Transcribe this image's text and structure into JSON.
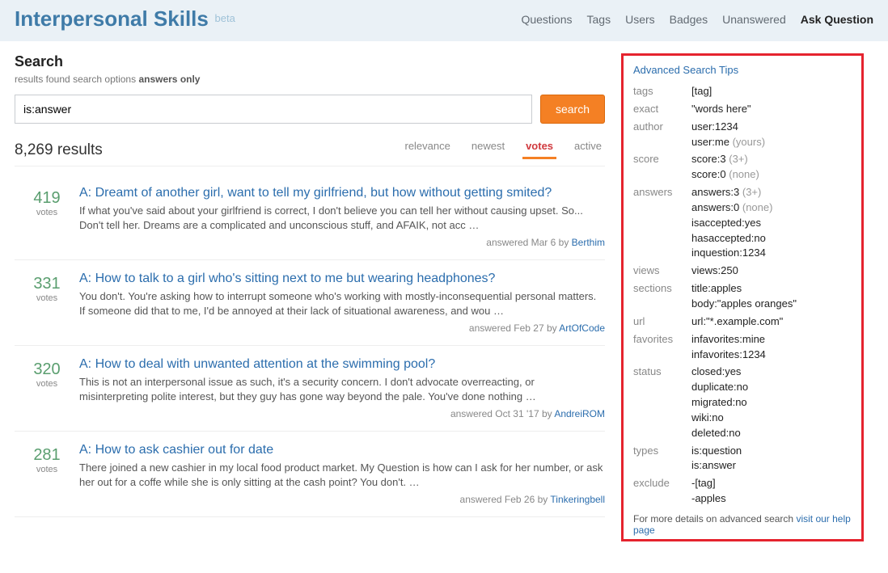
{
  "header": {
    "site_title": "Interpersonal Skills",
    "beta": "beta",
    "nav": {
      "questions": "Questions",
      "tags": "Tags",
      "users": "Users",
      "badges": "Badges",
      "unanswered": "Unanswered",
      "ask": "Ask Question"
    }
  },
  "search": {
    "heading": "Search",
    "sub_found": "results found",
    "sub_options": "search options",
    "sub_filter": "answers only",
    "query": "is:answer",
    "button": "search",
    "result_count": "8,269 results"
  },
  "tabs": {
    "relevance": "relevance",
    "newest": "newest",
    "votes": "votes",
    "active": "active"
  },
  "results": [
    {
      "votes": "419",
      "votes_lbl": "votes",
      "title": "A: Dreamt of another girl, want to tell my girlfriend, but how without getting smited?",
      "excerpt": "If what you've said about your girlfriend is correct, I don't believe you can tell her without causing upset. So... Don't tell her. Dreams are a complicated and unconscious stuff, and AFAIK, not acc …",
      "meta_prefix": "answered Mar 6 by ",
      "author": "Berthim"
    },
    {
      "votes": "331",
      "votes_lbl": "votes",
      "title": "A: How to talk to a girl who's sitting next to me but wearing headphones?",
      "excerpt": "You don't. You're asking how to interrupt someone who's working with mostly-inconsequential personal matters. If someone did that to me, I'd be annoyed at their lack of situational awareness, and wou …",
      "meta_prefix": "answered Feb 27 by ",
      "author": "ArtOfCode"
    },
    {
      "votes": "320",
      "votes_lbl": "votes",
      "title": "A: How to deal with unwanted attention at the swimming pool?",
      "excerpt": "This is not an interpersonal issue as such, it's a security concern. I don't advocate overreacting, or misinterpreting polite interest, but they guy has gone way beyond the pale. You've done nothing …",
      "meta_prefix": "answered Oct 31 '17 by ",
      "author": "AndreiROM"
    },
    {
      "votes": "281",
      "votes_lbl": "votes",
      "title": "A: How to ask cashier out for date",
      "excerpt": "There joined a new cashier in my local food product market. My Question is how can I ask for her number, or ask her out for a coffe while she is only sitting at the cash point? You don't. …",
      "meta_prefix": "answered Feb 26 by ",
      "author": "Tinkeringbell"
    }
  ],
  "tips": {
    "heading": "Advanced Search Tips",
    "rows": [
      {
        "label": "tags",
        "lines": [
          {
            "t": "[tag]"
          }
        ]
      },
      {
        "label": "exact",
        "lines": [
          {
            "t": "\"words here\""
          }
        ]
      },
      {
        "label": "author",
        "lines": [
          {
            "t": "user:1234"
          },
          {
            "t": "user:me ",
            "g": "(yours)"
          }
        ]
      },
      {
        "label": "score",
        "lines": [
          {
            "t": "score:3 ",
            "g": "(3+)"
          },
          {
            "t": "score:0 ",
            "g": "(none)"
          }
        ]
      },
      {
        "label": "answers",
        "lines": [
          {
            "t": "answers:3 ",
            "g": "(3+)"
          },
          {
            "t": "answers:0 ",
            "g": "(none)"
          },
          {
            "t": "isaccepted:yes"
          },
          {
            "t": "hasaccepted:no"
          },
          {
            "t": "inquestion:1234"
          }
        ]
      },
      {
        "label": "views",
        "lines": [
          {
            "t": "views:250"
          }
        ]
      },
      {
        "label": "sections",
        "lines": [
          {
            "t": "title:apples"
          },
          {
            "t": "body:\"apples oranges\""
          }
        ]
      },
      {
        "label": "url",
        "lines": [
          {
            "t": "url:\"*.example.com\""
          }
        ]
      },
      {
        "label": "favorites",
        "lines": [
          {
            "t": "infavorites:mine"
          },
          {
            "t": "infavorites:1234"
          }
        ]
      },
      {
        "label": "status",
        "lines": [
          {
            "t": "closed:yes"
          },
          {
            "t": "duplicate:no"
          },
          {
            "t": "migrated:no"
          },
          {
            "t": "wiki:no"
          },
          {
            "t": "deleted:no"
          }
        ]
      },
      {
        "label": "types",
        "lines": [
          {
            "t": "is:question"
          },
          {
            "t": "is:answer"
          }
        ]
      },
      {
        "label": "exclude",
        "lines": [
          {
            "t": "-[tag]"
          },
          {
            "t": "-apples"
          }
        ]
      }
    ],
    "footer_prefix": "For more details on advanced search ",
    "footer_link": "visit our help page"
  }
}
